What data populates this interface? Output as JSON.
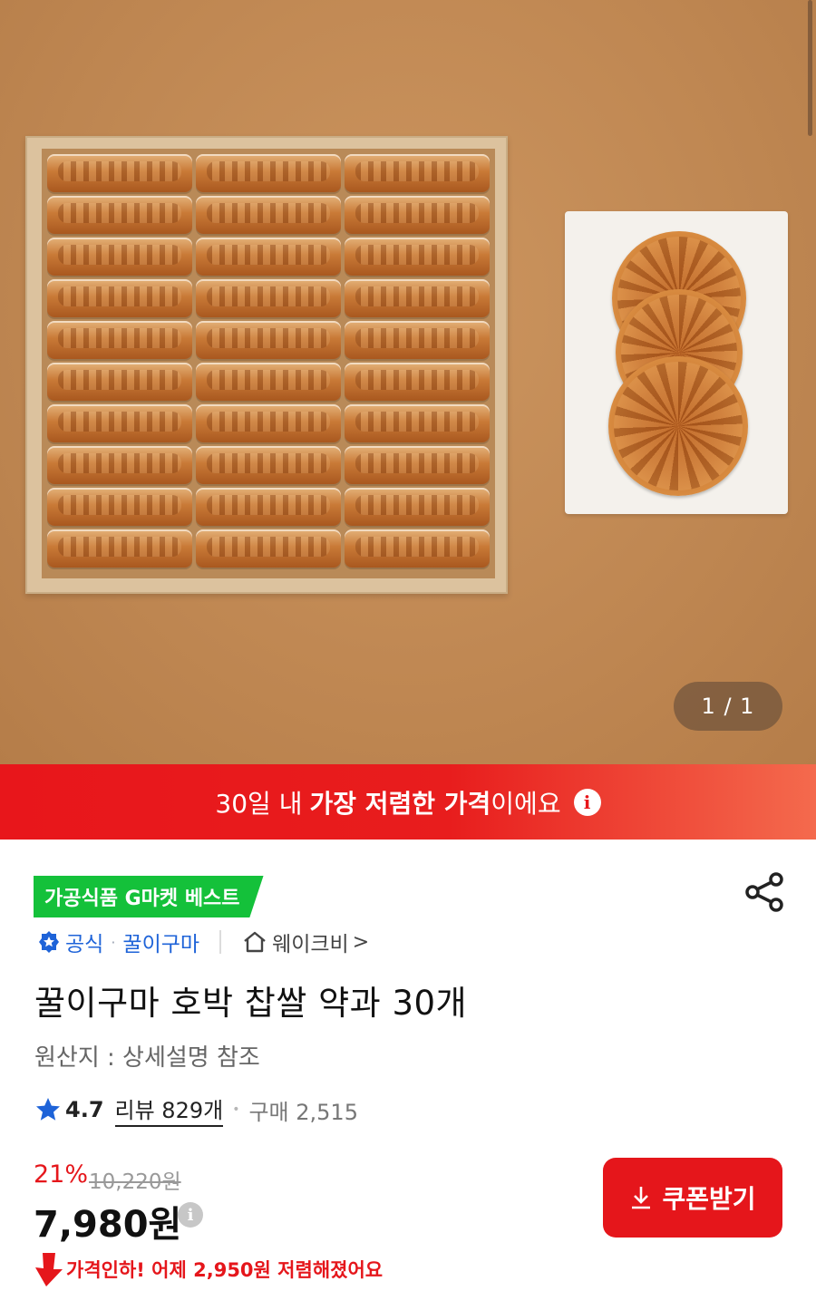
{
  "gallery": {
    "counter": "1 / 1",
    "image_alt": "꿀이구마 호박 찹쌀 약과 30개"
  },
  "banner": {
    "prefix": "30일 내",
    "highlight": "가장 저렴한 가격",
    "suffix": "이에요",
    "icon": "info-icon"
  },
  "best_tag": "가공식품 G마켓 베스트",
  "share_icon": "share-icon",
  "seller": {
    "official_label": "공식",
    "seller_name": "꿀이구마",
    "store_name": "웨이크비",
    "store_chevron": ">"
  },
  "product": {
    "title": "꿀이구마 호박 찹쌀 약과 30개",
    "origin": "원산지 : 상세설명 참조"
  },
  "rating": {
    "score": "4.7",
    "reviews": "리뷰 829개",
    "purchases": "구매 2,515"
  },
  "price": {
    "discount": "21%",
    "original": "10,220원",
    "sale": "7,980원"
  },
  "price_drop": "가격인하! 어제 2,950원 저렴해졌어요",
  "coupon_button": "쿠폰받기",
  "colors": {
    "accent_red": "#e5161b",
    "best_green": "#14c13a",
    "official_blue": "#1e63d8"
  }
}
